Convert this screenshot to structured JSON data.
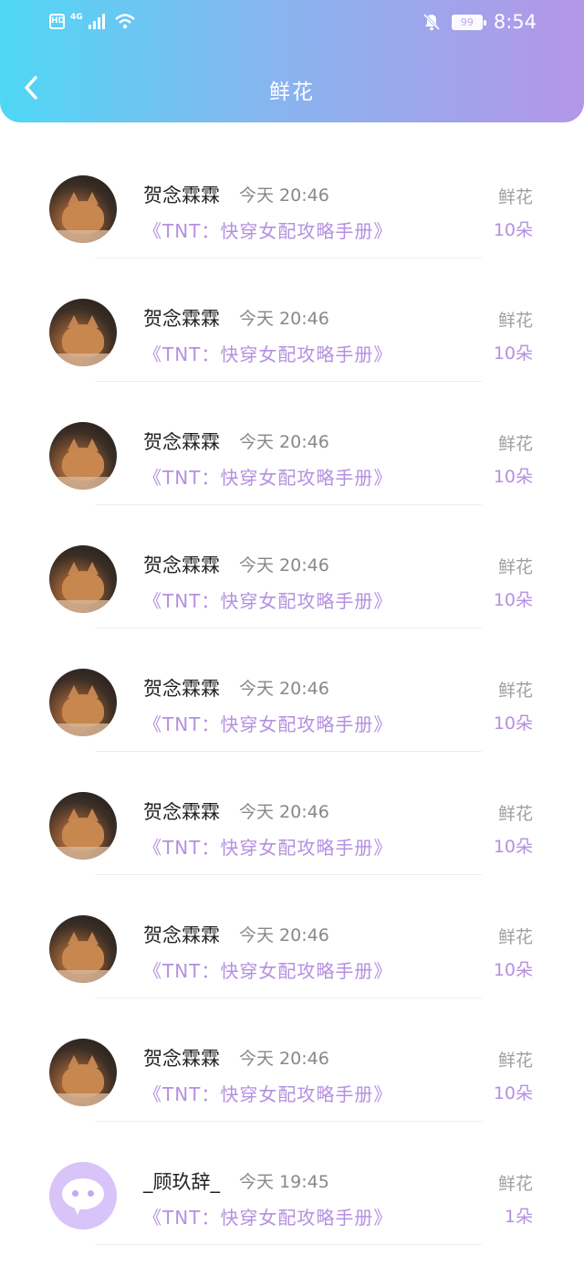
{
  "status_bar": {
    "hd": "HD",
    "network": "4G",
    "battery": "99",
    "time": "8:54"
  },
  "header": {
    "title": "鲜花"
  },
  "rows": [
    {
      "name": "贺念霖霖",
      "time": "今天 20:46",
      "book": "《TNT：快穿女配攻略手册》",
      "gift": "鲜花",
      "qty": "10朵"
    },
    {
      "name": "贺念霖霖",
      "time": "今天 20:46",
      "book": "《TNT：快穿女配攻略手册》",
      "gift": "鲜花",
      "qty": "10朵"
    },
    {
      "name": "贺念霖霖",
      "time": "今天 20:46",
      "book": "《TNT：快穿女配攻略手册》",
      "gift": "鲜花",
      "qty": "10朵"
    },
    {
      "name": "贺念霖霖",
      "time": "今天 20:46",
      "book": "《TNT：快穿女配攻略手册》",
      "gift": "鲜花",
      "qty": "10朵"
    },
    {
      "name": "贺念霖霖",
      "time": "今天 20:46",
      "book": "《TNT：快穿女配攻略手册》",
      "gift": "鲜花",
      "qty": "10朵"
    },
    {
      "name": "贺念霖霖",
      "time": "今天 20:46",
      "book": "《TNT：快穿女配攻略手册》",
      "gift": "鲜花",
      "qty": "10朵"
    },
    {
      "name": "贺念霖霖",
      "time": "今天 20:46",
      "book": "《TNT：快穿女配攻略手册》",
      "gift": "鲜花",
      "qty": "10朵"
    },
    {
      "name": "贺念霖霖",
      "time": "今天 20:46",
      "book": "《TNT：快穿女配攻略手册》",
      "gift": "鲜花",
      "qty": "10朵"
    },
    {
      "name": "_顾玖辞_",
      "time": "今天 19:45",
      "book": "《TNT：快穿女配攻略手册》",
      "gift": "鲜花",
      "qty": "1朵"
    }
  ],
  "icons": {
    "back": "back-arrow-icon",
    "mute": "bell-off-icon",
    "wifi": "wifi-icon",
    "signal": "signal-icon"
  }
}
